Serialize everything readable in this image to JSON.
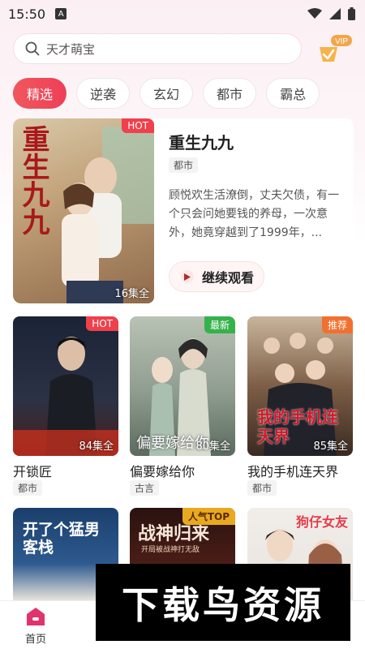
{
  "status_bar": {
    "time": "15:50",
    "a_icon": "A"
  },
  "search": {
    "query": "天才萌宝"
  },
  "vip": {
    "label": "VIP"
  },
  "tabs": [
    {
      "label": "精选",
      "active": true
    },
    {
      "label": "逆袭"
    },
    {
      "label": "玄幻"
    },
    {
      "label": "都市"
    },
    {
      "label": "霸总"
    }
  ],
  "featured": {
    "title": "重生九九",
    "poster_text": "重生九九",
    "badge": "HOT",
    "episodes": "16集全",
    "tag": "都市",
    "description": "顾悦欢生活潦倒，丈夫欠债，有一个只会问她要钱的养母，一次意外，她竟穿越到了1999年，...",
    "continue_label": "继续观看"
  },
  "cards": [
    {
      "title": "开锁匠",
      "tag": "都市",
      "badge": "HOT",
      "badge_color": "#f0404b",
      "episodes": "84集全"
    },
    {
      "title": "偏要嫁给你",
      "tag": "古言",
      "badge": "最新",
      "badge_color": "#35b24b",
      "episodes": "80集全",
      "poster_text": "偏要嫁给你"
    },
    {
      "title": "我的手机连天界",
      "tag": "都市",
      "badge": "推荐",
      "badge_color": "#f2702f",
      "episodes": "85集全",
      "poster_text": "我的手机连天界"
    }
  ],
  "cards_row2": [
    {
      "poster_text": "开了个猛男客栈"
    },
    {
      "badge": "人气TOP",
      "badge_color": "#e9a91f",
      "poster_text": "战神归来",
      "poster_subtext": "开局被战神打无敌"
    },
    {
      "poster_text": "狗仔女友"
    }
  ],
  "bottom_nav": {
    "home_label": "首页"
  },
  "watermark": {
    "text": "下载鸟资源"
  },
  "colors": {
    "accent": "#ee3f58",
    "home_icon": "#e1336c"
  }
}
